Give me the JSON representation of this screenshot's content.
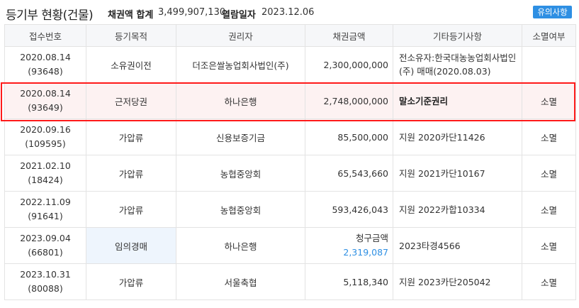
{
  "header": {
    "title": "등기부 현황(건물)",
    "sum_label": "채권액 합계",
    "sum_value": "3,499,907,130",
    "date_label": "열람일자",
    "date_value": "2023.12.06",
    "notice_button": "유의사항"
  },
  "columns": [
    "접수번호",
    "등기목적",
    "권리자",
    "채권금액",
    "기타등기사항",
    "소멸여부"
  ],
  "rows": [
    {
      "date": "2020.08.14",
      "no": "(93648)",
      "purpose": "소유권이전",
      "holder": "더조은쌀농업회사법인(주)",
      "amount": "2,300,000,000",
      "etc": "전소유자:한국대농농업회사법인(주) 매매(2020.08.03)",
      "status": ""
    },
    {
      "date": "2020.08.14",
      "no": "(93649)",
      "purpose": "근저당권",
      "holder": "하나은행",
      "amount": "2,748,000,000",
      "etc": "말소기준권리",
      "status": "소멸"
    },
    {
      "date": "2020.09.16",
      "no": "(109595)",
      "purpose": "가압류",
      "holder": "신용보증기금",
      "amount": "85,500,000",
      "etc": "지원 2020카단11426",
      "status": "소멸"
    },
    {
      "date": "2021.02.10",
      "no": "(18424)",
      "purpose": "가압류",
      "holder": "농협중앙회",
      "amount": "65,543,660",
      "etc": "지원 2021카단10167",
      "status": "소멸"
    },
    {
      "date": "2022.11.09",
      "no": "(91641)",
      "purpose": "가압류",
      "holder": "농협중앙회",
      "amount": "593,426,043",
      "etc": "지원 2022카합10334",
      "status": "소멸"
    },
    {
      "date": "2023.09.04",
      "no": "(66801)",
      "purpose": "임의경매",
      "holder": "하나은행",
      "amount_label": "청구금액",
      "amount": "2,319,087",
      "etc": "2023타경4566",
      "status": "소멸"
    },
    {
      "date": "2023.10.31",
      "no": "(80088)",
      "purpose": "가압류",
      "holder": "서울축협",
      "amount": "5,118,340",
      "etc": "지원 2023카단205042",
      "status": "소멸"
    }
  ],
  "colors": {
    "accent": "#2e8fe3",
    "highlight_border": "#ff1a1a",
    "highlight_bg": "#fdf2f2"
  }
}
